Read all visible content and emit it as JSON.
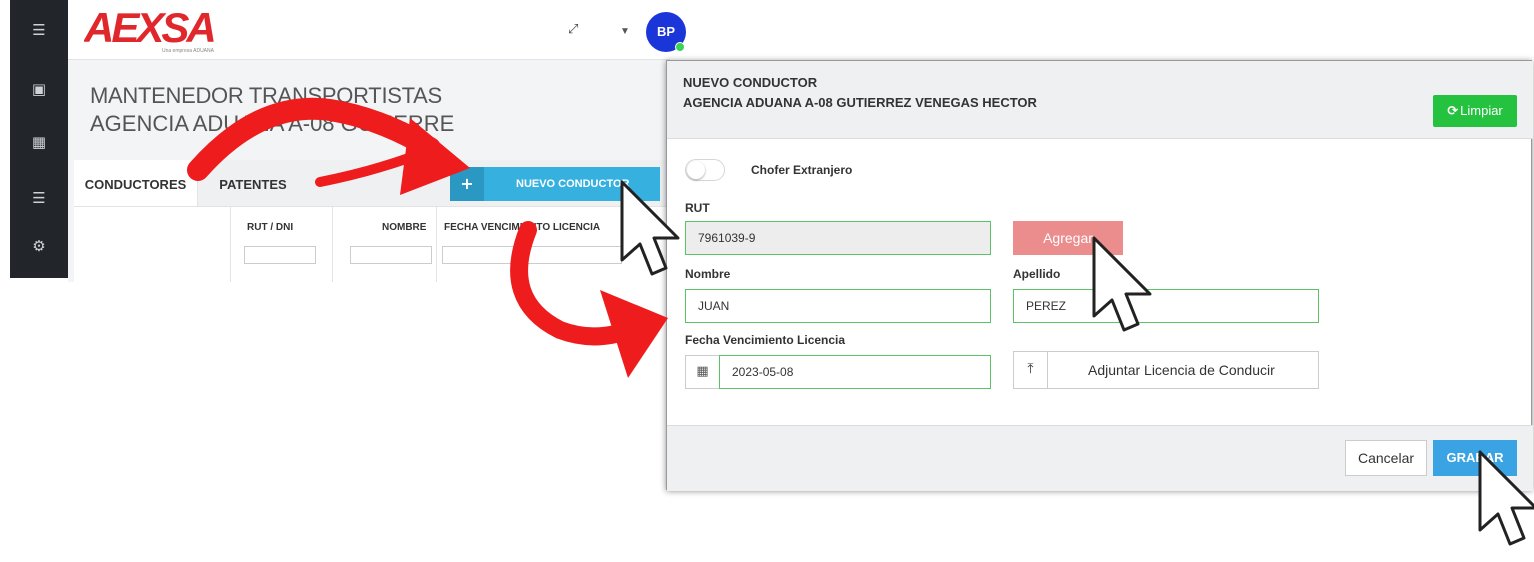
{
  "app": {
    "logo_text": "AEXSA",
    "logo_tagline": "Una empresa ADUANA",
    "avatar_initials": "BP",
    "page_title": "MANTENEDOR TRANSPORTISTAS",
    "page_subtitle": "AGENCIA ADUANA A-08 GUTIERRE",
    "tabs": [
      {
        "label": "CONDUCTORES",
        "active": true
      },
      {
        "label": "PATENTES",
        "active": false
      }
    ],
    "new_button_label": "NUEVO CONDUCTOR",
    "columns": [
      "RUT / DNI",
      "NOMBRE",
      "FECHA VENCIMIENTO LICENCIA"
    ]
  },
  "modal": {
    "title": "NUEVO CONDUCTOR",
    "subtitle": "AGENCIA ADUANA A-08 GUTIERREZ VENEGAS HECTOR",
    "clear_label": "Limpiar",
    "foreign_driver_label": "Chofer Extranjero",
    "foreign_driver_on": false,
    "rut_label": "RUT",
    "rut_value": "7961039-9",
    "add_label": "Agregar",
    "name_label": "Nombre",
    "name_value": "JUAN",
    "surname_label": "Apellido",
    "surname_value": "PEREZ",
    "license_date_label": "Fecha Vencimiento Licencia",
    "license_date_value": "2023-05-08",
    "attach_label": "Adjuntar Licencia de Conducir",
    "cancel_label": "Cancelar",
    "save_label": "GRABAR"
  },
  "colors": {
    "sidebar": "#22262b",
    "brand_red": "#e0282c",
    "primary_blue": "#36b1df",
    "success_green": "#25c23f",
    "danger_light": "#ec8d8d",
    "input_border_valid": "#5cc266",
    "arrow_red": "#ee1c1c"
  }
}
